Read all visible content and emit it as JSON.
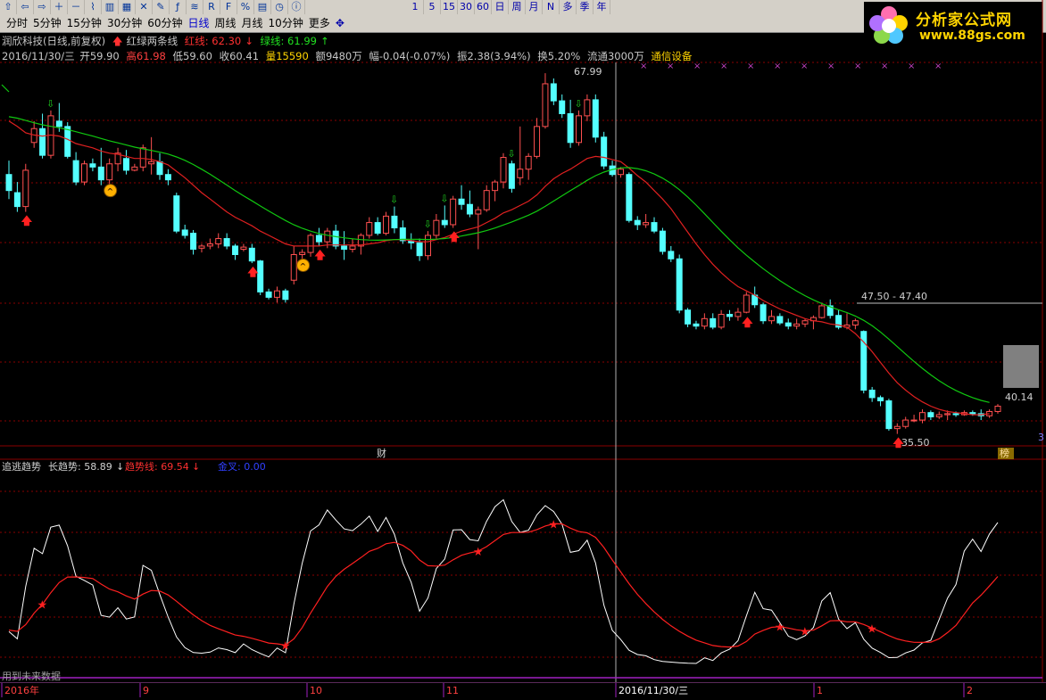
{
  "toolbar": {
    "icon_buttons": [
      "arrow-up-icon",
      "arrow-left-icon",
      "arrow-right-icon",
      "zoom-in-icon",
      "zoom-out-icon",
      "line-chart-icon",
      "bar-chart-icon",
      "grid-icon",
      "cross-icon",
      "drawing-icon",
      "formula-icon",
      "macd-icon",
      "rsi-icon",
      "f-icon",
      "percent-icon",
      "bookmark-icon",
      "clock-icon",
      "info-icon"
    ],
    "periods": [
      "分时",
      "5分钟",
      "15分钟",
      "30分钟",
      "60分钟",
      "日线",
      "周线",
      "月线",
      "10分钟",
      "更多"
    ],
    "active_period": "日线",
    "right_buttons": [
      "1",
      "5",
      "15",
      "30",
      "60",
      "日",
      "周",
      "月",
      "N",
      "多",
      "季",
      "年"
    ]
  },
  "logo": {
    "title": "分析家公式网",
    "url": "www.88gs.com"
  },
  "header": {
    "title": "润欣科技(日线,前复权)",
    "indicator_name": "红绿两条线",
    "red_line": "红线: 62.30",
    "green_line": "绿线: 61.99",
    "date": "2016/11/30/三",
    "open": "开59.90",
    "high": "高61.98",
    "low": "低59.60",
    "close": "收60.41",
    "volume": "量15590",
    "amount": "额9480万",
    "change": "幅-0.04(-0.07%)",
    "amplitude": "振2.38(3.94%)",
    "turnover": "换5.20%",
    "float": "流通3000万",
    "sector": "通信设备"
  },
  "price_labels": {
    "high": "67.99",
    "low": "35.50",
    "range": "47.50 - 47.40",
    "last": "40.14"
  },
  "markers": {
    "fin": "财",
    "list": "榜",
    "page": "3"
  },
  "sub": {
    "name": "追逃趋势",
    "long": "长趋势: 58.89",
    "trend": "趋势线: 69.54",
    "gold": "金叉: 0.00",
    "note": "用到未来数据"
  },
  "xaxis": [
    "2016年",
    "9",
    "10",
    "11",
    "2016/11/30/三",
    "1",
    "2"
  ],
  "colors": {
    "up": "#ff5050",
    "down": "#54ffff",
    "red_line": "#e02020",
    "green_line": "#10c810",
    "trend": "#ff2020",
    "long": "#ffffff",
    "grid": "#8a0000"
  },
  "chart_data": {
    "type": "candlestick",
    "ohlc": [
      [
        58.5,
        59.8,
        56.2,
        57.0
      ],
      [
        56.8,
        57.8,
        55.0,
        55.5
      ],
      [
        55.5,
        59.5,
        55.0,
        58.9
      ],
      [
        61.5,
        63.5,
        61.0,
        62.8
      ],
      [
        62.8,
        64.2,
        60.0,
        60.3
      ],
      [
        60.3,
        64.5,
        60.0,
        64.0
      ],
      [
        63.5,
        65.2,
        62.5,
        63.0
      ],
      [
        63.0,
        63.4,
        60.0,
        60.2
      ],
      [
        59.8,
        60.6,
        57.5,
        57.8
      ],
      [
        57.8,
        59.8,
        57.5,
        59.5
      ],
      [
        59.5,
        60.0,
        58.8,
        59.2
      ],
      [
        59.2,
        61.0,
        57.5,
        58.0
      ],
      [
        58.0,
        60.0,
        57.5,
        59.5
      ],
      [
        59.5,
        61.0,
        58.8,
        60.5
      ],
      [
        60.0,
        60.8,
        58.5,
        58.9
      ],
      [
        58.9,
        59.5,
        58.8,
        59.2
      ],
      [
        59.2,
        61.3,
        58.8,
        61.0
      ],
      [
        59.5,
        62.0,
        58.5,
        59.7
      ],
      [
        59.7,
        60.5,
        58.0,
        58.5
      ],
      [
        58.5,
        59.0,
        57.5,
        58.0
      ],
      [
        56.5,
        56.8,
        53.0,
        53.2
      ],
      [
        53.3,
        53.8,
        52.5,
        52.8
      ],
      [
        53.0,
        53.3,
        51.0,
        51.5
      ],
      [
        51.6,
        52.0,
        51.2,
        51.8
      ],
      [
        51.8,
        52.5,
        51.5,
        52.0
      ],
      [
        52.0,
        53.0,
        51.6,
        52.5
      ],
      [
        52.5,
        53.0,
        51.5,
        51.8
      ],
      [
        51.8,
        52.0,
        50.5,
        51.0
      ],
      [
        51.5,
        52.0,
        51.3,
        51.7
      ],
      [
        51.6,
        52.0,
        50.2,
        50.4
      ],
      [
        50.4,
        50.5,
        47.2,
        47.5
      ],
      [
        47.5,
        47.8,
        46.8,
        47.0
      ],
      [
        47.0,
        48.0,
        46.5,
        47.6
      ],
      [
        47.6,
        47.8,
        46.5,
        46.8
      ],
      [
        48.6,
        51.8,
        48.2,
        51.0
      ],
      [
        51.0,
        51.5,
        50.5,
        51.2
      ],
      [
        51.2,
        53.0,
        50.8,
        52.8
      ],
      [
        52.8,
        53.5,
        51.8,
        52.2
      ],
      [
        52.2,
        53.5,
        51.6,
        53.2
      ],
      [
        53.2,
        53.8,
        51.5,
        51.8
      ],
      [
        51.8,
        53.2,
        50.5,
        51.5
      ],
      [
        51.5,
        52.5,
        51.2,
        51.8
      ],
      [
        51.8,
        53.0,
        51.0,
        52.8
      ],
      [
        52.8,
        54.5,
        52.5,
        54.0
      ],
      [
        54.0,
        54.5,
        52.8,
        53.0
      ],
      [
        53.0,
        55.0,
        52.8,
        54.6
      ],
      [
        54.6,
        55.5,
        53.0,
        53.5
      ],
      [
        53.5,
        54.2,
        52.0,
        52.3
      ],
      [
        52.3,
        53.0,
        51.5,
        52.1
      ],
      [
        52.1,
        52.5,
        50.4,
        50.9
      ],
      [
        50.9,
        53.2,
        50.5,
        52.8
      ],
      [
        52.8,
        54.8,
        52.5,
        54.2
      ],
      [
        54.2,
        55.6,
        53.5,
        53.8
      ],
      [
        53.8,
        56.5,
        53.5,
        56.2
      ],
      [
        56.2,
        57.5,
        55.2,
        55.7
      ],
      [
        55.7,
        57.0,
        54.5,
        54.8
      ],
      [
        54.8,
        55.5,
        51.5,
        55.2
      ],
      [
        55.2,
        57.5,
        55.0,
        57.0
      ],
      [
        57.0,
        58.0,
        56.0,
        57.8
      ],
      [
        57.8,
        60.5,
        57.2,
        60.1
      ],
      [
        59.5,
        59.8,
        56.8,
        57.2
      ],
      [
        58.2,
        63.0,
        57.5,
        59.0
      ],
      [
        59.0,
        60.5,
        58.0,
        60.2
      ],
      [
        60.2,
        63.8,
        60.0,
        63.0
      ],
      [
        63.0,
        67.99,
        62.8,
        67.0
      ],
      [
        67.0,
        67.5,
        65.0,
        65.4
      ],
      [
        65.4,
        66.0,
        63.8,
        64.2
      ],
      [
        64.2,
        65.5,
        61.0,
        61.5
      ],
      [
        61.5,
        64.5,
        61.2,
        64.0
      ],
      [
        64.0,
        66.0,
        63.5,
        65.5
      ],
      [
        65.5,
        66.0,
        61.5,
        62.0
      ],
      [
        62.0,
        62.5,
        59.0,
        59.3
      ],
      [
        59.3,
        59.8,
        58.3,
        58.5
      ],
      [
        58.5,
        59.2,
        58.2,
        59.0
      ],
      [
        58.5,
        58.7,
        54.0,
        54.2
      ],
      [
        54.2,
        54.6,
        53.3,
        53.8
      ],
      [
        53.8,
        54.8,
        53.5,
        54.0
      ],
      [
        54.0,
        54.5,
        53.0,
        53.2
      ],
      [
        53.2,
        53.5,
        51.0,
        51.3
      ],
      [
        51.3,
        51.8,
        50.3,
        50.6
      ],
      [
        50.6,
        51.0,
        45.5,
        45.8
      ],
      [
        45.8,
        46.0,
        44.2,
        44.5
      ],
      [
        44.5,
        44.8,
        44.0,
        44.3
      ],
      [
        44.3,
        45.5,
        44.0,
        45.0
      ],
      [
        45.0,
        45.5,
        44.0,
        44.2
      ],
      [
        44.2,
        45.8,
        44.0,
        45.4
      ],
      [
        45.4,
        45.8,
        44.8,
        45.2
      ],
      [
        45.2,
        46.0,
        44.8,
        45.6
      ],
      [
        45.6,
        47.5,
        45.5,
        47.2
      ],
      [
        47.2,
        48.0,
        46.0,
        46.3
      ],
      [
        46.3,
        46.5,
        44.5,
        44.8
      ],
      [
        44.8,
        45.8,
        44.5,
        45.2
      ],
      [
        45.2,
        45.5,
        44.4,
        44.6
      ],
      [
        44.6,
        45.0,
        44.0,
        44.3
      ],
      [
        44.3,
        45.0,
        44.0,
        44.5
      ],
      [
        44.5,
        45.0,
        44.2,
        44.8
      ],
      [
        44.8,
        45.3,
        44.0,
        45.1
      ],
      [
        45.1,
        46.5,
        45.0,
        46.2
      ],
      [
        46.2,
        46.8,
        45.0,
        45.3
      ],
      [
        45.3,
        45.8,
        44.0,
        44.2
      ],
      [
        44.2,
        45.5,
        44.0,
        44.4
      ],
      [
        44.4,
        45.0,
        44.0,
        44.8
      ],
      [
        43.8,
        43.9,
        38.0,
        38.3
      ],
      [
        38.3,
        38.6,
        37.2,
        37.6
      ],
      [
        37.6,
        37.8,
        36.8,
        37.3
      ],
      [
        37.3,
        37.5,
        34.5,
        34.7
      ],
      [
        34.7,
        35.2,
        34.2,
        34.9
      ],
      [
        34.9,
        35.8,
        34.7,
        35.5
      ],
      [
        35.5,
        36.0,
        35.3,
        35.5
      ],
      [
        35.5,
        36.5,
        35.2,
        36.2
      ],
      [
        36.2,
        36.4,
        35.5,
        35.8
      ],
      [
        35.8,
        36.3,
        35.6,
        36.0
      ],
      [
        36.0,
        36.4,
        35.5,
        36.1
      ],
      [
        36.1,
        36.3,
        35.8,
        36.0
      ],
      [
        36.0,
        36.4,
        35.9,
        36.2
      ],
      [
        36.2,
        36.4,
        35.9,
        36.1
      ],
      [
        36.1,
        36.5,
        35.5,
        35.9
      ],
      [
        35.9,
        36.5,
        35.7,
        36.3
      ],
      [
        36.3,
        37.0,
        36.1,
        36.8
      ]
    ],
    "red_line": [
      63.5,
      63.0,
      62.4,
      62.2,
      62.1,
      62.2,
      62.1,
      61.8,
      61.4,
      61.2,
      61.0,
      60.7,
      60.5,
      60.4,
      60.2,
      60.0,
      60.0,
      59.9,
      59.7,
      59.4,
      58.8,
      58.2,
      57.5,
      56.8,
      56.2,
      55.6,
      55.0,
      54.5,
      54.1,
      53.7,
      53.2,
      52.8,
      52.4,
      52.0,
      51.8,
      51.8,
      51.8,
      51.8,
      51.9,
      51.9,
      51.9,
      51.9,
      51.9,
      52.0,
      52.1,
      52.3,
      52.4,
      52.4,
      52.3,
      52.2,
      52.2,
      52.4,
      52.6,
      52.9,
      53.2,
      53.4,
      53.6,
      54.0,
      54.4,
      54.9,
      55.2,
      55.6,
      56.0,
      56.6,
      57.4,
      58.1,
      58.6,
      59.0,
      59.5,
      60.0,
      60.2,
      60.1,
      59.9,
      59.7,
      59.1,
      58.4,
      57.8,
      57.0,
      56.2,
      55.3,
      54.2,
      53.1,
      52.0,
      51.0,
      50.1,
      49.3,
      48.6,
      48.0,
      47.6,
      47.2,
      46.7,
      46.3,
      45.9,
      45.6,
      45.3,
      45.0,
      44.8,
      44.7,
      44.5,
      44.4,
      44.2,
      43.6,
      42.8,
      41.9,
      40.9,
      39.9,
      39.0,
      38.3,
      37.7,
      37.2,
      36.8,
      36.5,
      36.3,
      36.2,
      36.1,
      36.0,
      36.0,
      36.1
    ]
  }
}
